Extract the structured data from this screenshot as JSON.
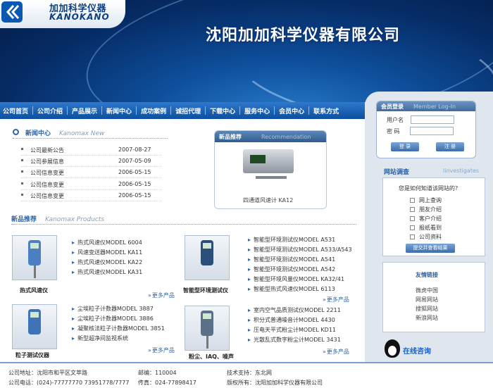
{
  "header": {
    "logo_cn": "加加科学仪器",
    "logo_en": "KANOKANO",
    "company_name": "沈阳加加科学仪器有限公司"
  },
  "nav": [
    "公司首页",
    "公司介绍",
    "产品展示",
    "新闻中心",
    "成功案例",
    "诚招代理",
    "下载中心",
    "服务中心",
    "会员中心",
    "联系方式"
  ],
  "login": {
    "title": "会员登录",
    "title_en": "Member Log-In",
    "username_label": "用户名",
    "password_label": "密  码",
    "login_button": "登 录",
    "register_button": "注 册"
  },
  "survey": {
    "title": "网站调查",
    "title_en": "Iinvestigates",
    "question": "您是如何知道该网站的?",
    "options": [
      "网上查询",
      "朋友介绍",
      "客户介绍",
      "报纸看到",
      "公司资料"
    ],
    "submit": "提交并查看结果"
  },
  "friend_links": {
    "title": "友情链接",
    "items": [
      "微虎中国",
      "网易网站",
      "搜狐网站",
      "新浪网站"
    ]
  },
  "online_service": "在线咨询",
  "news": {
    "title": "新闻中心",
    "title_en": "Kanomax  New",
    "items": [
      {
        "title": "公司最新公告",
        "date": "2007-08-27"
      },
      {
        "title": "公司参展信息",
        "date": "2007-05-09"
      },
      {
        "title": "公司信息变更",
        "date": "2006-05-15"
      },
      {
        "title": "公司信息变更",
        "date": "2006-05-15"
      },
      {
        "title": "公司信息变更",
        "date": "2006-05-15"
      }
    ]
  },
  "recommend": {
    "title": "新品推荐",
    "title_en": "Recommendation",
    "caption": "四通道风速计 KA12"
  },
  "products": {
    "title": "新品推荐",
    "title_en": "Kanomax  Products",
    "more": "更多产品",
    "groups": [
      {
        "caption": "热式风速仪",
        "items": [
          "热式风速仪MODEL 6004",
          "风速变送器MODEL KA11",
          "热式风速仪MODEL KA22",
          "热式风速仪MODEL KA31"
        ]
      },
      {
        "caption": "智能型环境测试仪",
        "items": [
          "智能型环境测试仪MODEL A531",
          "智能型环境测试仪MODEL A533/A543",
          "智能型环境测试仪MODEL A541",
          "智能型环境测试仪MODEL A542",
          "智能型环境风量仪MODEL KA32/41",
          "智能型热式风速仪MODEL 6113"
        ]
      },
      {
        "caption": "粒子测试仪器",
        "items": [
          "尘埃粒子计数器MODEL 3887",
          "尘埃粒子计数器MODEL 3886",
          "凝聚核法粒子计数器MODEL 3851",
          "新型超净间监视系统"
        ]
      },
      {
        "caption": "粉尘、IAQ、噪声",
        "items": [
          "室内空气品质测试仪MODEL 2211",
          "积分式普通噪音计MODEL 4430",
          "压电天平式粉尘计MODEL KD11",
          "光散乱式数字粉尘计MODEL 3431"
        ]
      }
    ]
  },
  "footer": {
    "address": "公司地址：沈阳市和平区文萃路",
    "phone": "公司电话：(024)-77777770 73951778/7777",
    "postcode": "邮编：110004",
    "fax": "传真：024-77898417",
    "tech": "技术支持：东北网",
    "copyright": "版权所有：沈阳加加科学仪器有限公司"
  }
}
